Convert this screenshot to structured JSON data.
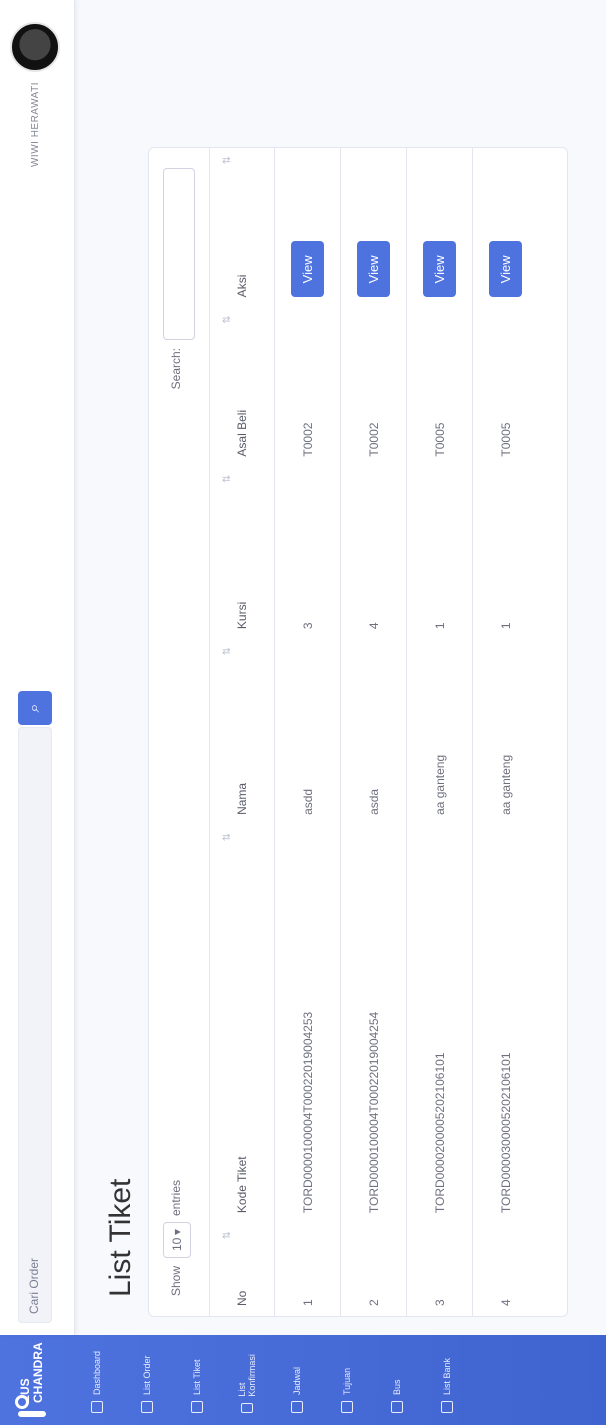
{
  "sidebar": {
    "brand": {
      "line1": "EUS",
      "line2": "CHANDRA"
    },
    "items": [
      {
        "label": "Dashboard",
        "icon": "dashboard-icon"
      },
      {
        "label": "List Order",
        "icon": "list-icon"
      },
      {
        "label": "List Tiket",
        "icon": "ticket-icon"
      },
      {
        "label": "List Konfirmasi",
        "icon": "user-icon"
      },
      {
        "label": "Jadwal",
        "icon": "calendar-icon"
      },
      {
        "label": "Tujuan",
        "icon": "location-icon"
      },
      {
        "label": "Bus",
        "icon": "bus-icon"
      },
      {
        "label": "List Bank",
        "icon": "bank-icon"
      }
    ]
  },
  "topbar": {
    "search_placeholder": "Cari Order",
    "search_icon": "search-icon",
    "user_name": "WIWI HERAWATI"
  },
  "page": {
    "title": "List Tiket"
  },
  "controls": {
    "show": "Show",
    "length": "10",
    "entries": "entries",
    "search": "Search:"
  },
  "table": {
    "headers": [
      "No",
      "Kode Tiket",
      "Nama",
      "Kursi",
      "Asal Beli",
      "Aksi"
    ],
    "rows": [
      {
        "no": "1",
        "kode": "TORD0000100004T00022019004253",
        "nama": "asdd",
        "kursi": "3",
        "asal": "T0002",
        "aksi": "View"
      },
      {
        "no": "2",
        "kode": "TORD0000100004T00022019004254",
        "nama": "asda",
        "kursi": "4",
        "asal": "T0002",
        "aksi": "View"
      },
      {
        "no": "3",
        "kode": "TORD0000200005202106101",
        "nama": "aa ganteng",
        "kursi": "1",
        "asal": "T0005",
        "aksi": "View"
      },
      {
        "no": "4",
        "kode": "TORD0000300005202106101",
        "nama": "aa ganteng",
        "kursi": "1",
        "asal": "T0005",
        "aksi": "View"
      }
    ]
  },
  "colors": {
    "primary": "#4e73df",
    "text": "#6e707e"
  }
}
